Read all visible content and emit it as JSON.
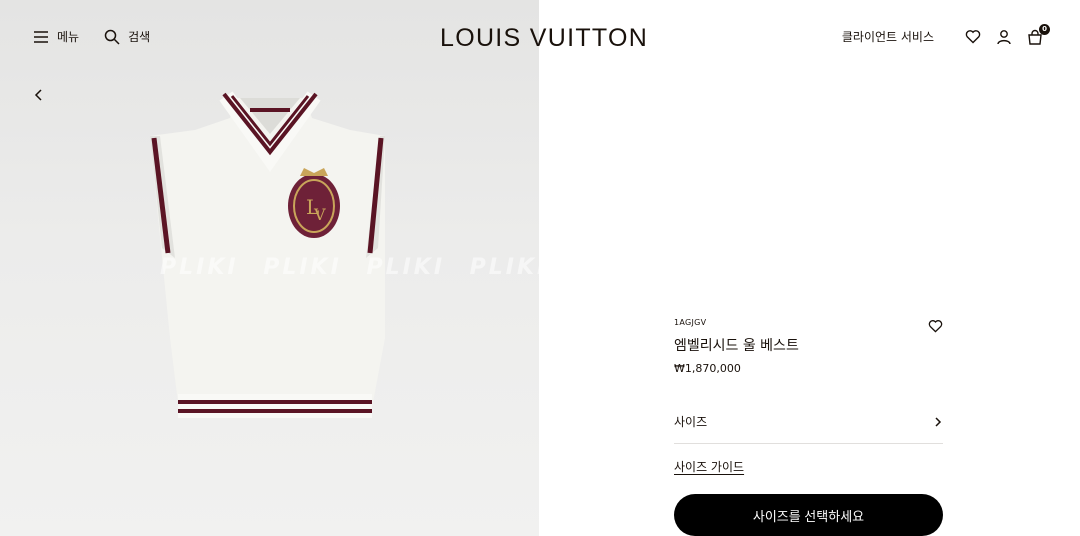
{
  "header": {
    "menu_label": "메뉴",
    "search_label": "검색",
    "logo_text": "LOUIS VUITTON",
    "client_service_label": "클라이언트 서비스",
    "cart_count": "0"
  },
  "gallery": {
    "watermark_text": "PLIKI PLIKI PLIKI PLIKI PLIKI"
  },
  "product": {
    "sku": "1AGJGV",
    "title": "엠벨리시드 울 베스트",
    "price": "₩1,870,000",
    "size_label": "사이즈",
    "size_guide_label": "사이즈 가이드",
    "cta_label": "사이즈를 선택하세요"
  },
  "colors": {
    "vest_body": "#f4f4f0",
    "stripe": "#5a1424",
    "crest": "#6e2138",
    "gold": "#c9a55a"
  }
}
